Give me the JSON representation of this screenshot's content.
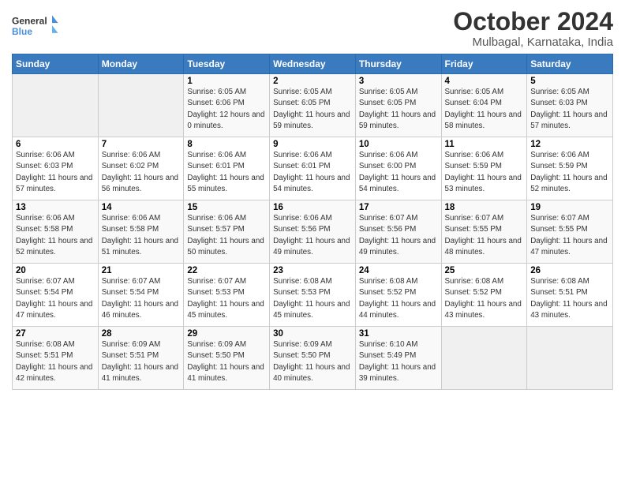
{
  "logo": {
    "line1": "General",
    "line2": "Blue"
  },
  "title": "October 2024",
  "location": "Mulbagal, Karnataka, India",
  "days_of_week": [
    "Sunday",
    "Monday",
    "Tuesday",
    "Wednesday",
    "Thursday",
    "Friday",
    "Saturday"
  ],
  "weeks": [
    [
      {
        "day": "",
        "info": ""
      },
      {
        "day": "",
        "info": ""
      },
      {
        "day": "1",
        "info": "Sunrise: 6:05 AM\nSunset: 6:06 PM\nDaylight: 12 hours\nand 0 minutes."
      },
      {
        "day": "2",
        "info": "Sunrise: 6:05 AM\nSunset: 6:05 PM\nDaylight: 11 hours\nand 59 minutes."
      },
      {
        "day": "3",
        "info": "Sunrise: 6:05 AM\nSunset: 6:05 PM\nDaylight: 11 hours\nand 59 minutes."
      },
      {
        "day": "4",
        "info": "Sunrise: 6:05 AM\nSunset: 6:04 PM\nDaylight: 11 hours\nand 58 minutes."
      },
      {
        "day": "5",
        "info": "Sunrise: 6:05 AM\nSunset: 6:03 PM\nDaylight: 11 hours\nand 57 minutes."
      }
    ],
    [
      {
        "day": "6",
        "info": "Sunrise: 6:06 AM\nSunset: 6:03 PM\nDaylight: 11 hours\nand 57 minutes."
      },
      {
        "day": "7",
        "info": "Sunrise: 6:06 AM\nSunset: 6:02 PM\nDaylight: 11 hours\nand 56 minutes."
      },
      {
        "day": "8",
        "info": "Sunrise: 6:06 AM\nSunset: 6:01 PM\nDaylight: 11 hours\nand 55 minutes."
      },
      {
        "day": "9",
        "info": "Sunrise: 6:06 AM\nSunset: 6:01 PM\nDaylight: 11 hours\nand 54 minutes."
      },
      {
        "day": "10",
        "info": "Sunrise: 6:06 AM\nSunset: 6:00 PM\nDaylight: 11 hours\nand 54 minutes."
      },
      {
        "day": "11",
        "info": "Sunrise: 6:06 AM\nSunset: 5:59 PM\nDaylight: 11 hours\nand 53 minutes."
      },
      {
        "day": "12",
        "info": "Sunrise: 6:06 AM\nSunset: 5:59 PM\nDaylight: 11 hours\nand 52 minutes."
      }
    ],
    [
      {
        "day": "13",
        "info": "Sunrise: 6:06 AM\nSunset: 5:58 PM\nDaylight: 11 hours\nand 52 minutes."
      },
      {
        "day": "14",
        "info": "Sunrise: 6:06 AM\nSunset: 5:58 PM\nDaylight: 11 hours\nand 51 minutes."
      },
      {
        "day": "15",
        "info": "Sunrise: 6:06 AM\nSunset: 5:57 PM\nDaylight: 11 hours\nand 50 minutes."
      },
      {
        "day": "16",
        "info": "Sunrise: 6:06 AM\nSunset: 5:56 PM\nDaylight: 11 hours\nand 49 minutes."
      },
      {
        "day": "17",
        "info": "Sunrise: 6:07 AM\nSunset: 5:56 PM\nDaylight: 11 hours\nand 49 minutes."
      },
      {
        "day": "18",
        "info": "Sunrise: 6:07 AM\nSunset: 5:55 PM\nDaylight: 11 hours\nand 48 minutes."
      },
      {
        "day": "19",
        "info": "Sunrise: 6:07 AM\nSunset: 5:55 PM\nDaylight: 11 hours\nand 47 minutes."
      }
    ],
    [
      {
        "day": "20",
        "info": "Sunrise: 6:07 AM\nSunset: 5:54 PM\nDaylight: 11 hours\nand 47 minutes."
      },
      {
        "day": "21",
        "info": "Sunrise: 6:07 AM\nSunset: 5:54 PM\nDaylight: 11 hours\nand 46 minutes."
      },
      {
        "day": "22",
        "info": "Sunrise: 6:07 AM\nSunset: 5:53 PM\nDaylight: 11 hours\nand 45 minutes."
      },
      {
        "day": "23",
        "info": "Sunrise: 6:08 AM\nSunset: 5:53 PM\nDaylight: 11 hours\nand 45 minutes."
      },
      {
        "day": "24",
        "info": "Sunrise: 6:08 AM\nSunset: 5:52 PM\nDaylight: 11 hours\nand 44 minutes."
      },
      {
        "day": "25",
        "info": "Sunrise: 6:08 AM\nSunset: 5:52 PM\nDaylight: 11 hours\nand 43 minutes."
      },
      {
        "day": "26",
        "info": "Sunrise: 6:08 AM\nSunset: 5:51 PM\nDaylight: 11 hours\nand 43 minutes."
      }
    ],
    [
      {
        "day": "27",
        "info": "Sunrise: 6:08 AM\nSunset: 5:51 PM\nDaylight: 11 hours\nand 42 minutes."
      },
      {
        "day": "28",
        "info": "Sunrise: 6:09 AM\nSunset: 5:51 PM\nDaylight: 11 hours\nand 41 minutes."
      },
      {
        "day": "29",
        "info": "Sunrise: 6:09 AM\nSunset: 5:50 PM\nDaylight: 11 hours\nand 41 minutes."
      },
      {
        "day": "30",
        "info": "Sunrise: 6:09 AM\nSunset: 5:50 PM\nDaylight: 11 hours\nand 40 minutes."
      },
      {
        "day": "31",
        "info": "Sunrise: 6:10 AM\nSunset: 5:49 PM\nDaylight: 11 hours\nand 39 minutes."
      },
      {
        "day": "",
        "info": ""
      },
      {
        "day": "",
        "info": ""
      }
    ]
  ]
}
